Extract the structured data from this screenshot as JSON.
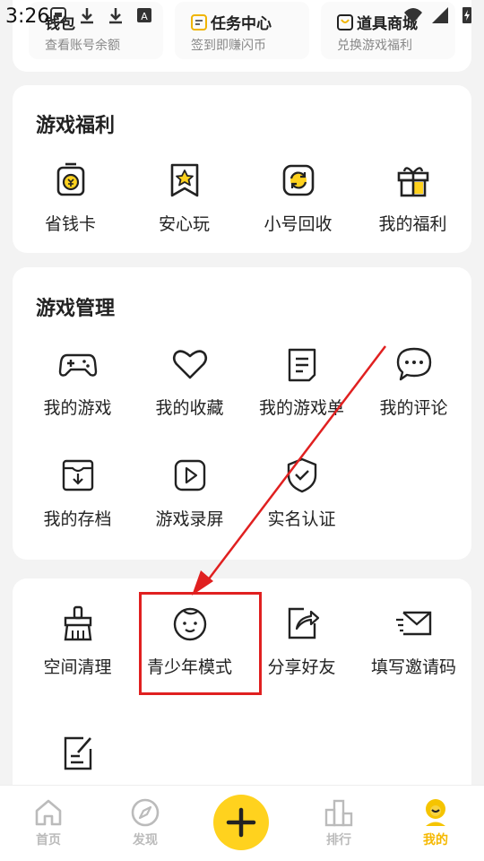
{
  "status_bar": {
    "time": "3:26"
  },
  "wallet": {
    "items": [
      {
        "title": "钱包",
        "subtitle": "查看账号余额"
      },
      {
        "title": "任务中心",
        "subtitle": "签到即赚闪币"
      },
      {
        "title": "道具商城",
        "subtitle": "兑换游戏福利"
      }
    ]
  },
  "game_welfare": {
    "title": "游戏福利",
    "items": [
      {
        "label": "省钱卡",
        "icon": "savings-card-icon"
      },
      {
        "label": "安心玩",
        "icon": "star-badge-icon"
      },
      {
        "label": "小号回收",
        "icon": "recycle-icon"
      },
      {
        "label": "我的福利",
        "icon": "gift-icon"
      }
    ]
  },
  "game_management": {
    "title": "游戏管理",
    "items": [
      {
        "label": "我的游戏",
        "icon": "gamepad-icon"
      },
      {
        "label": "我的收藏",
        "icon": "heart-icon"
      },
      {
        "label": "我的游戏单",
        "icon": "list-doc-icon"
      },
      {
        "label": "我的评论",
        "icon": "comment-icon"
      },
      {
        "label": "我的存档",
        "icon": "archive-icon"
      },
      {
        "label": "游戏录屏",
        "icon": "play-record-icon"
      },
      {
        "label": "实名认证",
        "icon": "shield-check-icon"
      }
    ]
  },
  "tools": {
    "items": [
      {
        "label": "空间清理",
        "icon": "broom-icon"
      },
      {
        "label": "青少年模式",
        "icon": "baby-face-icon"
      },
      {
        "label": "分享好友",
        "icon": "share-icon"
      },
      {
        "label": "填写邀请码",
        "icon": "envelope-icon"
      }
    ]
  },
  "bottom_nav": {
    "items": [
      {
        "label": "首页",
        "icon": "home-icon"
      },
      {
        "label": "发现",
        "icon": "compass-icon"
      },
      {
        "label": "排行",
        "icon": "ranking-icon"
      },
      {
        "label": "我的",
        "icon": "profile-icon"
      }
    ],
    "active": "我的"
  },
  "colors": {
    "accent": "#ffd21e",
    "annotation_red": "#e02020",
    "active_nav": "#f5b800"
  }
}
